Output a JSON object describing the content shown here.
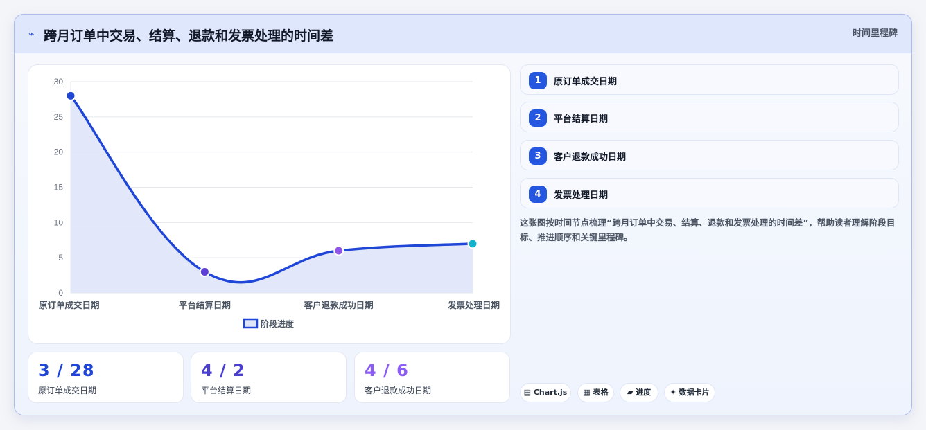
{
  "header": {
    "icon": "⌁",
    "title": "跨月订单中交易、结算、退款和发票处理的时间差",
    "tag": "时间里程碑"
  },
  "chart_data": {
    "type": "line",
    "categories": [
      "原订单成交日期",
      "平台结算日期",
      "客户退款成功日期",
      "发票处理日期"
    ],
    "series": [
      {
        "name": "阶段进度",
        "values": [
          28,
          3,
          6,
          7
        ]
      }
    ],
    "ylim": [
      0,
      30
    ],
    "yticks": [
      0,
      5,
      10,
      15,
      20,
      25,
      30
    ],
    "grid": true,
    "legend": "bottom",
    "colors": {
      "line": "#1f46d6",
      "fill": "#dfe5f8",
      "points": [
        "#1f46d6",
        "#5b3fd6",
        "#8e55e8",
        "#14b3cc"
      ]
    }
  },
  "stats": [
    {
      "value": "3 / 28",
      "label": "原订单成交日期",
      "color": "#1f46d6"
    },
    {
      "value": "4 / 2",
      "label": "平台结算日期",
      "color": "#4a3fd0"
    },
    {
      "value": "4 / 6",
      "label": "客户退款成功日期",
      "color": "#8b5cf6"
    }
  ],
  "steps": [
    {
      "num": "1",
      "label": "原订单成交日期"
    },
    {
      "num": "2",
      "label": "平台结算日期"
    },
    {
      "num": "3",
      "label": "客户退款成功日期"
    },
    {
      "num": "4",
      "label": "发票处理日期"
    }
  ],
  "description": "这张图按时间节点梳理“跨月订单中交易、结算、退款和发票处理的时间差”，帮助读者理解阶段目标、推进顺序和关键里程碑。",
  "pills": [
    {
      "label": "▤ Chart.js"
    },
    {
      "label": "▦ 表格"
    },
    {
      "label": "▰ 进度"
    },
    {
      "label": "✦ 数据卡片"
    }
  ]
}
